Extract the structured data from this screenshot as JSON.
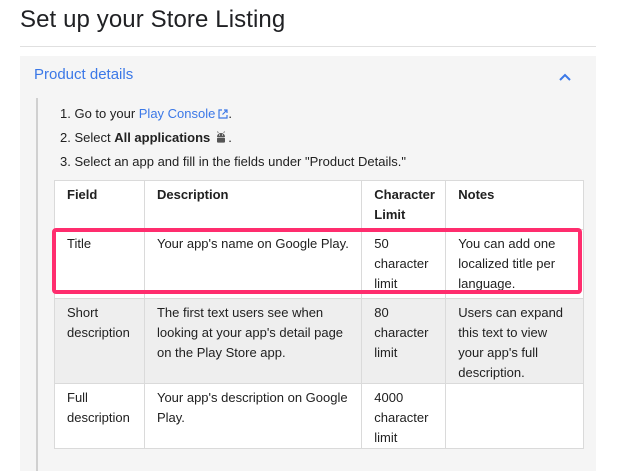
{
  "page": {
    "title": "Set up your Store Listing"
  },
  "accordion": {
    "header": "Product details",
    "expanded": true,
    "chevron_icon": "chevron-up-icon"
  },
  "steps": {
    "s1_prefix": "1. Go to your ",
    "s1_link": "Play Console",
    "s1_suffix": ".",
    "s2_prefix": "2. Select ",
    "s2_bold": "All applications",
    "s2_suffix": ".",
    "s3": "3. Select an app and fill in the fields under \"Product Details.\""
  },
  "table": {
    "headers": {
      "field": "Field",
      "description": "Description",
      "limit": "Character Limit",
      "notes": "Notes"
    },
    "rows": [
      {
        "field": "Title",
        "description": "Your app's name on Google Play.",
        "limit": "50 character limit",
        "notes": "You can add one localized title per language."
      },
      {
        "field": "Short description",
        "description": "The first text users see when looking at your app's detail page on the Play Store app.",
        "limit": "80 character limit",
        "notes": "Users can expand this text to view your app's full description."
      },
      {
        "field": "Full description",
        "description": "Your app's description on Google Play.",
        "limit": "4000 character limit",
        "notes": ""
      }
    ]
  },
  "colors": {
    "link": "#3b78e7",
    "highlight": "#ff2d6e"
  }
}
